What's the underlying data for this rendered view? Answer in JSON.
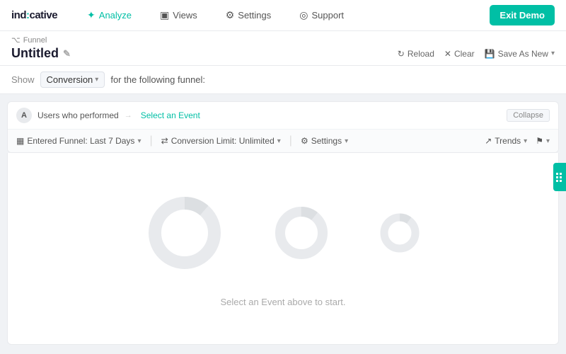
{
  "logo": {
    "text_ind": "ind",
    "text_icative": ":cative"
  },
  "nav": {
    "items": [
      {
        "id": "analyze",
        "label": "Analyze",
        "icon": "⚙",
        "active": true
      },
      {
        "id": "views",
        "label": "Views",
        "icon": "📄",
        "active": false
      },
      {
        "id": "settings",
        "label": "Settings",
        "icon": "⚙",
        "active": false
      },
      {
        "id": "support",
        "label": "Support",
        "icon": "👤",
        "active": false
      }
    ],
    "exit_demo": "Exit Demo"
  },
  "subheader": {
    "funnel_label": "Funnel",
    "title": "Untitled",
    "edit_icon": "✎",
    "actions": [
      {
        "id": "reload",
        "icon": "↻",
        "label": "Reload"
      },
      {
        "id": "clear",
        "icon": "✕",
        "label": "Clear"
      },
      {
        "id": "save-as-new",
        "icon": "💾",
        "label": "Save As New"
      }
    ]
  },
  "show_bar": {
    "label": "Show",
    "dropdown_value": "Conversion",
    "after_text": "for the following funnel:"
  },
  "segment": {
    "avatar": "A",
    "description": "Users who performed",
    "select_event_label": "Select an Event",
    "collapse_label": "Collapse"
  },
  "filters": {
    "entered_funnel": "Entered Funnel: Last 7 Days",
    "conversion_limit": "Conversion Limit: Unlimited",
    "settings": "Settings",
    "trends": "Trends",
    "flag": ""
  },
  "empty_state": {
    "message": "Select an Event above to start."
  },
  "donuts": [
    {
      "size": 120,
      "radius": 42,
      "stroke": 18,
      "opacity": 0.15
    },
    {
      "size": 90,
      "radius": 30,
      "stroke": 14,
      "opacity": 0.12
    },
    {
      "size": 68,
      "radius": 22,
      "stroke": 11,
      "opacity": 0.1
    }
  ]
}
